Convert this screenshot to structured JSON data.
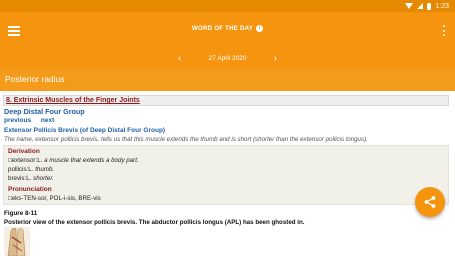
{
  "status_bar": {
    "time": "1:23"
  },
  "app_bar": {
    "title": "WORD OF THE DAY",
    "info_glyph": "i",
    "date": "27 April 2020",
    "prev_glyph": "‹",
    "next_glyph": "›",
    "accent_color": "#f5950f"
  },
  "word": {
    "title": "Posterior radius"
  },
  "content": {
    "chapter": "8. Extrinsic Muscles of the Finger Joints",
    "group": "Deep Distal Four Group",
    "nav": {
      "previous": "previous",
      "next": "next"
    },
    "term": "Extensor Pollicis Brevis (of Deep Distal Four Group)",
    "description": "The name, extensor pollicis brevis, tells us that this muscle extends the thumb and is short (shorter than the extensor pollicis longus).",
    "derivation": {
      "label": "Derivation",
      "lines": [
        {
          "prefix": "□extensor:L.",
          "meaning": "a muscle that extends a body part."
        },
        {
          "prefix": "pollicis:L.",
          "meaning": "thumb."
        },
        {
          "prefix": "brevis:L.",
          "meaning": "shorter."
        }
      ]
    },
    "pronunciation": {
      "label": "Pronunciation",
      "text": "□eks-TEN-sor, POL-i-sis, BRE-vis"
    },
    "figure": {
      "label": "Figure 8-11",
      "caption": "Posterior view of the extensor pollicis brevis. The abductor pollicis longus (APL) has been ghosted in."
    }
  },
  "fab": {
    "icon": "share-icon"
  }
}
